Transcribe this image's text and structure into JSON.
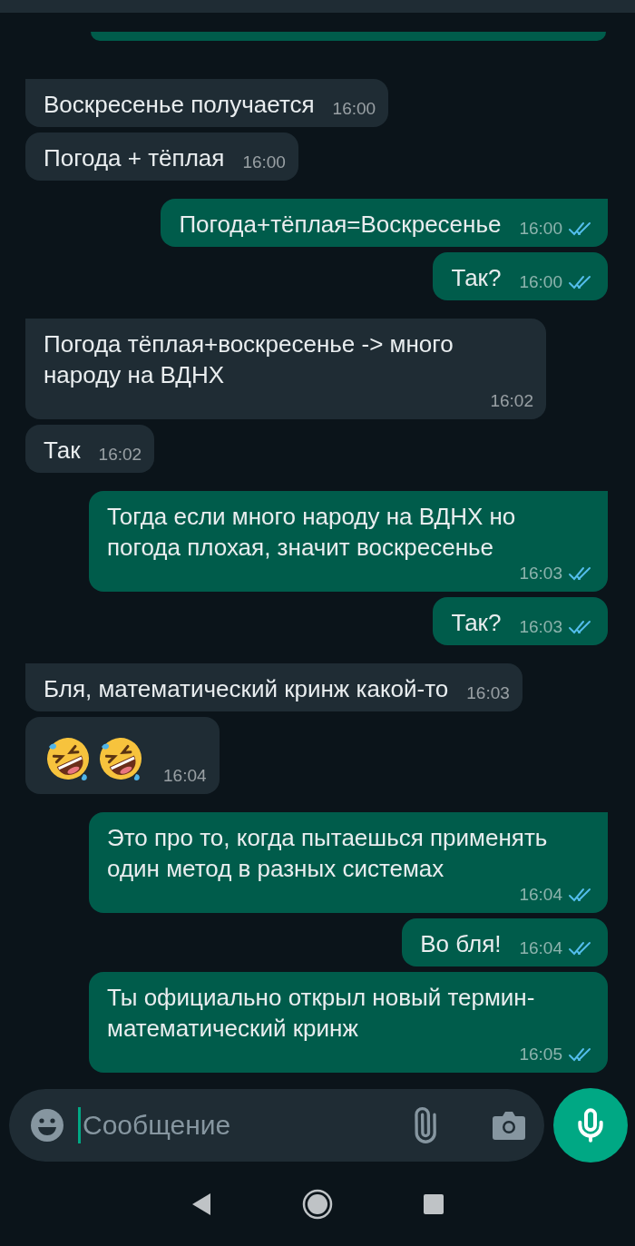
{
  "chat": {
    "messages": [
      {
        "outgoing": false,
        "kind": "text",
        "tail": true,
        "text": "Воскресенье получается",
        "time": "16:00"
      },
      {
        "outgoing": false,
        "kind": "text",
        "tail": false,
        "text": "Погода + тёплая",
        "time": "16:00"
      },
      {
        "outgoing": true,
        "kind": "text",
        "tail": true,
        "text": "Погода+тёплая=Воскресенье",
        "time": "16:00",
        "read": true
      },
      {
        "outgoing": true,
        "kind": "text",
        "tail": false,
        "text": "Так?",
        "time": "16:00",
        "read": true
      },
      {
        "outgoing": false,
        "kind": "text",
        "tail": true,
        "text": "Погода тёплая+воскресенье -> много народу на ВДНХ",
        "time": "16:02"
      },
      {
        "outgoing": false,
        "kind": "text",
        "tail": false,
        "text": "Так",
        "time": "16:02"
      },
      {
        "outgoing": true,
        "kind": "text",
        "tail": true,
        "text": "Тогда если много народу на ВДНХ но погода плохая, значит воскресенье",
        "time": "16:03",
        "read": true
      },
      {
        "outgoing": true,
        "kind": "text",
        "tail": false,
        "text": "Так?",
        "time": "16:03",
        "read": true
      },
      {
        "outgoing": false,
        "kind": "text",
        "tail": true,
        "text": "Бля, математический кринж какой-то",
        "time": "16:03"
      },
      {
        "outgoing": false,
        "kind": "emoji",
        "tail": false,
        "emojis": [
          {
            "kind": "rofl"
          },
          {
            "kind": "rofl"
          }
        ],
        "time": "16:04"
      },
      {
        "outgoing": true,
        "kind": "text",
        "tail": true,
        "text": "Это про то, когда пытаешься применять один метод в разных системах",
        "time": "16:04",
        "read": true
      },
      {
        "outgoing": true,
        "kind": "text",
        "tail": false,
        "text": "Во бля!",
        "time": "16:04",
        "read": true
      },
      {
        "outgoing": true,
        "kind": "text",
        "tail": false,
        "text": "Ты официально открыл новый термин-математический кринж",
        "time": "16:05",
        "read": true
      }
    ]
  },
  "composer": {
    "placeholder": "Сообщение"
  }
}
